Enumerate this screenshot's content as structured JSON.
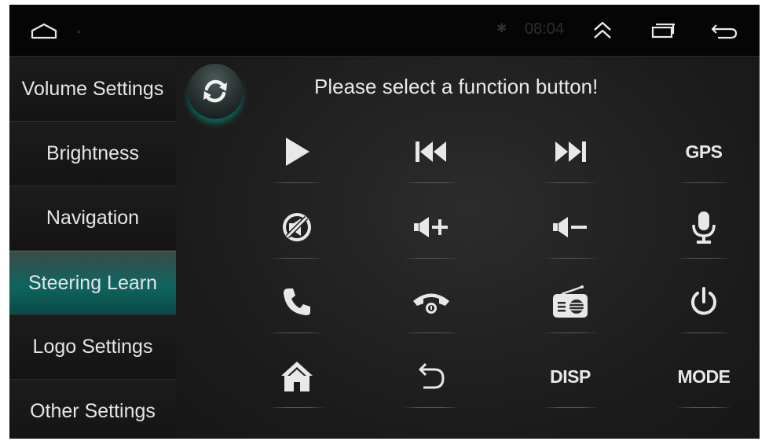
{
  "status_bar": {
    "time": "08:04",
    "icons": [
      "home-icon",
      "bluetooth-icon",
      "expand-up-icon",
      "recents-icon",
      "back-icon"
    ]
  },
  "sidebar": {
    "items": [
      {
        "label": "Volume Settings",
        "active": false
      },
      {
        "label": "Brightness",
        "active": false
      },
      {
        "label": "Navigation",
        "active": false
      },
      {
        "label": "Steering Learn",
        "active": true
      },
      {
        "label": "Logo Settings",
        "active": false
      },
      {
        "label": "Other Settings",
        "active": false
      }
    ]
  },
  "main": {
    "prompt": "Please select a function button!",
    "refresh_icon": "refresh-icon",
    "functions": [
      {
        "icon": "play-icon"
      },
      {
        "icon": "previous-track-icon"
      },
      {
        "icon": "next-track-icon"
      },
      {
        "icon": "gps-text",
        "label": "GPS"
      },
      {
        "icon": "mute-icon"
      },
      {
        "icon": "volume-up-icon"
      },
      {
        "icon": "volume-down-icon"
      },
      {
        "icon": "microphone-icon"
      },
      {
        "icon": "phone-answer-icon"
      },
      {
        "icon": "phone-hangup-icon"
      },
      {
        "icon": "radio-icon"
      },
      {
        "icon": "power-icon"
      },
      {
        "icon": "home-icon"
      },
      {
        "icon": "back-icon"
      },
      {
        "icon": "disp-text",
        "label": "DISP"
      },
      {
        "icon": "mode-text",
        "label": "MODE"
      }
    ]
  },
  "colors": {
    "accent": "#0e6560",
    "background": "#1a1a1a",
    "text": "#e6e6e6"
  }
}
